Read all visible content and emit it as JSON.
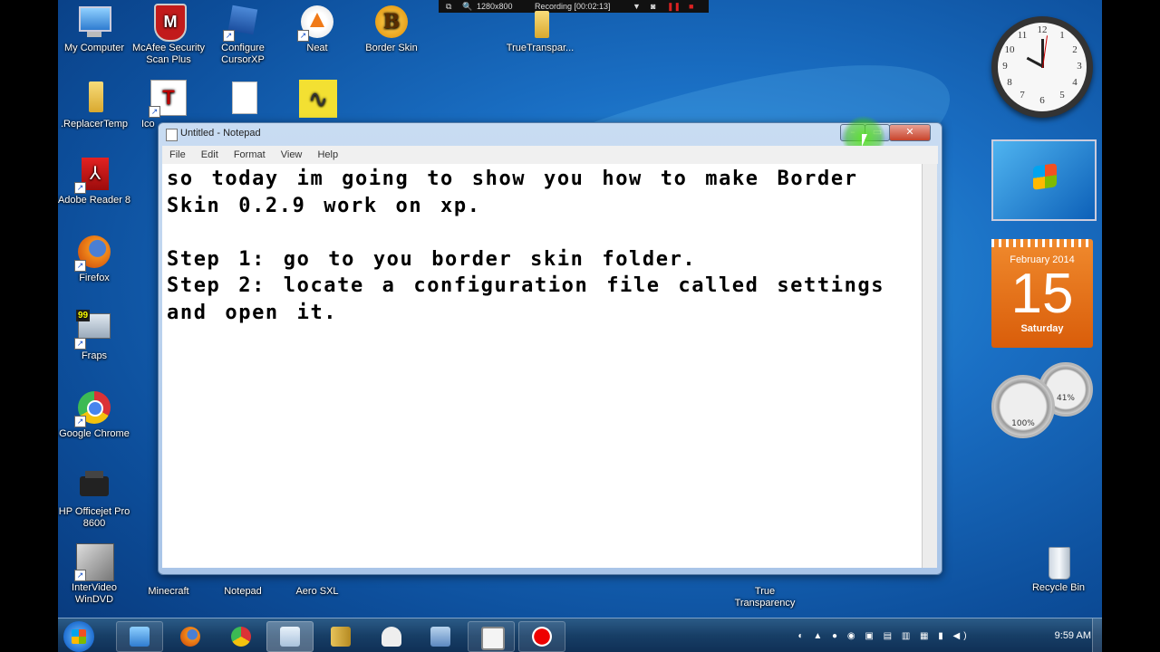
{
  "recording_bar": {
    "resolution": "1280x800",
    "status": "Recording [00:02:13]"
  },
  "desktop": {
    "icons": {
      "my_computer": "My Computer",
      "mcafee": "McAfee Security Scan Plus",
      "cursorxp": "Configure CursorXP",
      "neat": "Neat",
      "border_skin": "Border Skin",
      "true_transparency_top": "TrueTranspar...",
      "replacer": ".ReplacerTemp",
      "ico_partial": "Ico",
      "adobe": "Adobe Reader 8",
      "firefox": "Firefox",
      "fraps": "Fraps",
      "chrome": "Google Chrome",
      "hp": "HP Officejet Pro 8600",
      "intervideo": "InterVideo WinDVD",
      "minecraft": "Minecraft",
      "notepad": "Notepad",
      "aero": "Aero SXL",
      "true_transparency": "True Transparency",
      "recycle_bin": "Recycle Bin"
    }
  },
  "notepad": {
    "title": "Untitled - Notepad",
    "menu": [
      "File",
      "Edit",
      "Format",
      "View",
      "Help"
    ],
    "content": "so today im going to show you how to make Border Skin 0.2.9 work on xp.\n\nStep 1: go to you border skin folder.\nStep 2: locate a configuration file called settings and open it."
  },
  "gadgets": {
    "calendar": {
      "month": "February 2014",
      "day": "15",
      "weekday": "Saturday"
    },
    "meters": {
      "cpu": "100%",
      "memory": "41%"
    }
  },
  "taskbar": {
    "clock": "9:59 AM"
  },
  "colors": {
    "accent_orange": "#e66f16",
    "desktop_blue": "#1a6fc4",
    "notepad_frame": "#b9d1ee"
  }
}
